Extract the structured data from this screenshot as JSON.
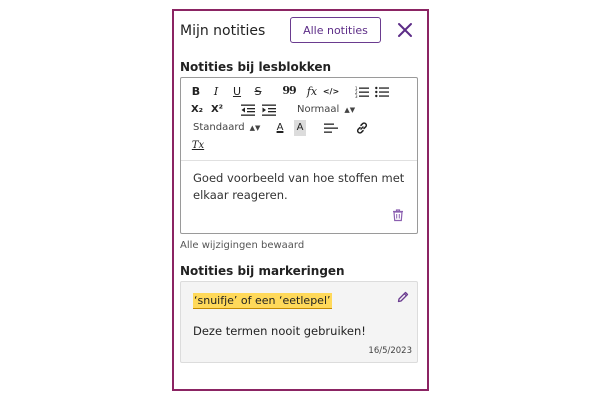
{
  "panel": {
    "title": "Mijn notities",
    "all_notes_label": "Alle notities",
    "accent_color": "#8b2463",
    "button_color": "#5c2c87"
  },
  "lesson_notes": {
    "title": "Notities bij lesblokken",
    "toolbar": {
      "bold": "B",
      "italic": "I",
      "underline": "U",
      "strike": "S",
      "quote": "99",
      "formula": "fx",
      "code": "</>",
      "ordered_list_icon": "ordered-list-icon",
      "bullet_list_icon": "bullet-list-icon",
      "subscript": "X₂",
      "superscript": "X²",
      "indent_decrease_icon": "indent-decrease-icon",
      "indent_increase_icon": "indent-increase-icon",
      "size_select": "Normaal",
      "font_select": "Standaard",
      "font_color": "A",
      "background_color": "A",
      "align_icon": "align-left-icon",
      "link_icon": "link-icon",
      "clear_format": "Tx"
    },
    "note_text": "Goed voorbeeld van hoe stoffen met elkaar reageren.",
    "saved_status": "Alle wijzigingen bewaard"
  },
  "highlight_notes": {
    "title": "Notities bij markeringen",
    "highlight_text": "‘snuifje’ of een ‘eetlepel’",
    "highlight_color": "#ffd95a",
    "note_text": "Deze termen nooit gebruiken!",
    "date": "16/5/2023"
  }
}
